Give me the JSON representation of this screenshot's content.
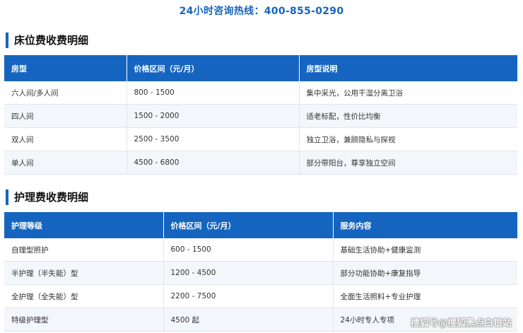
{
  "hotline": "24小时咨询热线：400-855-0290",
  "bed_section": {
    "title": "床位费收费明细",
    "headers": [
      "房型",
      "价格区间（元/月）",
      "房型说明"
    ],
    "rows": [
      [
        "六人间/多人间",
        "800 - 1500",
        "集中采光，公用干湿分离卫浴"
      ],
      [
        "四人间",
        "1500 - 2000",
        "适老标配，性价比均衡"
      ],
      [
        "双人间",
        "2500 - 3500",
        "独立卫浴，兼顾隐私与探视"
      ],
      [
        "单人间",
        "4500 - 6800",
        "部分带阳台，尊享独立空间"
      ]
    ]
  },
  "care_section": {
    "title": "护理费收费明细",
    "headers": [
      "护理等级",
      "价格区间（元/月）",
      "服务内容"
    ],
    "rows": [
      [
        "自理型照护",
        "600 - 1500",
        "基础生活协助+健康监测"
      ],
      [
        "半护理（半失能）型",
        "1200 - 4500",
        "部分功能协助+康复指导"
      ],
      [
        "全护理（全失能）型",
        "2200 - 7500",
        "全面生活照料+专业护理"
      ],
      [
        "特级护理型",
        "4500 起",
        "24小时专人专项"
      ]
    ]
  },
  "watermark": "搜狐号@搜狐黑点白银站"
}
